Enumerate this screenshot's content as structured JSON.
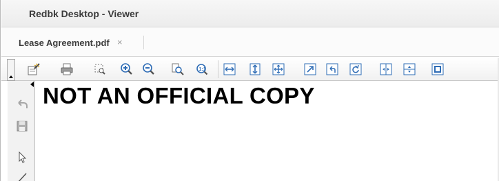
{
  "window": {
    "title": "Redbk Desktop - Viewer"
  },
  "tabs": [
    {
      "label": "Lease Agreement.pdf",
      "close_glyph": "×"
    }
  ],
  "toolbar": {
    "tools": [
      {
        "name": "annotate-icon"
      },
      {
        "name": "print-icon"
      },
      {
        "name": "marquee-zoom-icon"
      },
      {
        "name": "zoom-in-icon"
      },
      {
        "name": "zoom-out-icon"
      },
      {
        "name": "zoom-page-icon"
      },
      {
        "name": "zoom-actual-icon"
      },
      {
        "name": "fit-width-icon"
      },
      {
        "name": "fit-height-icon"
      },
      {
        "name": "fit-window-icon"
      },
      {
        "name": "rotate-right-icon"
      },
      {
        "name": "rotate-left-icon"
      },
      {
        "name": "rotate-refresh-icon"
      },
      {
        "name": "split-vertical-icon"
      },
      {
        "name": "split-horizontal-icon"
      },
      {
        "name": "full-screen-icon"
      }
    ]
  },
  "left_panel": {
    "tools": [
      {
        "name": "undo-icon"
      },
      {
        "name": "save-icon"
      },
      {
        "name": "select-pointer-icon"
      },
      {
        "name": "line-tool-icon"
      }
    ]
  },
  "document": {
    "watermark_text": "NOT AN OFFICIAL COPY"
  },
  "colors": {
    "accent_blue": "#2e6cb5",
    "icon_gray": "#8a8a8a"
  }
}
